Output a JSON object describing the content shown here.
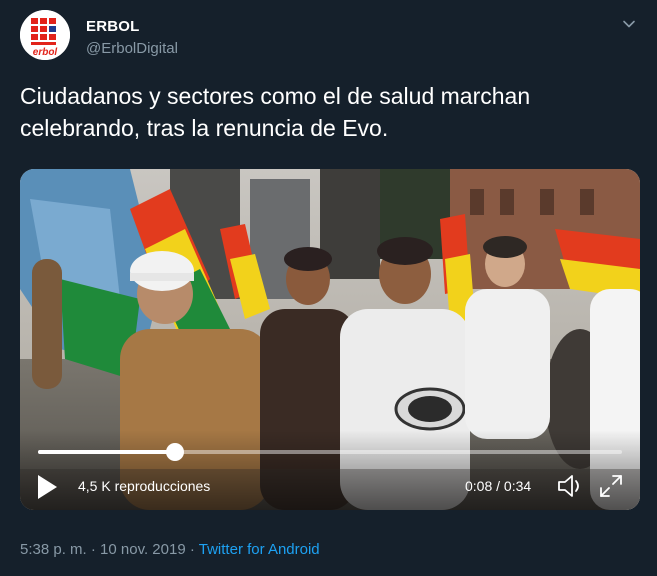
{
  "author": {
    "name": "ERBOL",
    "handle": "@ErbolDigital",
    "avatar_text": "erbol"
  },
  "tweet": {
    "text": "Ciudadanos y sectores como el de salud marchan celebrando, tras la renuncia de Evo."
  },
  "video": {
    "views": "4,5 K reproducciones",
    "time": "0:08 / 0:34",
    "progress": 0.235
  },
  "meta": {
    "time": "5:38 p. m.",
    "date": "10 nov. 2019",
    "separator": "·",
    "source": "Twitter for Android"
  },
  "icons": {
    "caret": "chevron-down-icon",
    "play": "play-icon",
    "volume": "volume-icon",
    "fullscreen": "fullscreen-icon"
  },
  "colors": {
    "background": "#15202b",
    "secondary_text": "#8899a6",
    "link": "#1da1f2",
    "brand_red": "#e2231a"
  }
}
